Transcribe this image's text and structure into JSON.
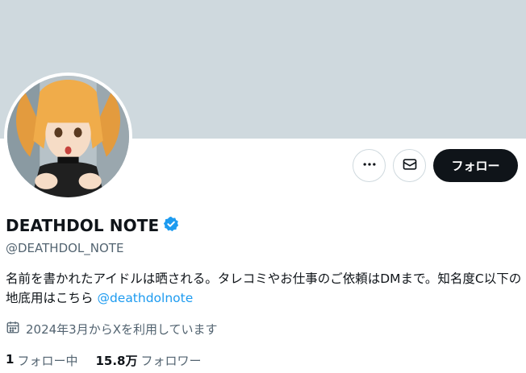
{
  "profile": {
    "display_name": "DEATHDOL NOTE",
    "handle": "@DEATHDOL_NOTE",
    "verified": true,
    "bio_text": "名前を書かれたアイドルは晒される。タレコミやお仕事のご依頼はDMまで。知名度C以下の地底用はこちら ",
    "bio_link": "@deathdolnote",
    "joined": "2024年3月からXを利用しています",
    "following_count": "1",
    "following_label": "フォロー中",
    "followers_count": "15.8万",
    "followers_label": "フォロワー"
  },
  "actions": {
    "more_icon": "more-horizontal-icon",
    "message_icon": "envelope-icon",
    "follow_label": "フォロー"
  },
  "colors": {
    "banner": "#cfd9de",
    "accent": "#1d9bf0",
    "primary_button": "#0f1419",
    "secondary_text": "#536471"
  }
}
